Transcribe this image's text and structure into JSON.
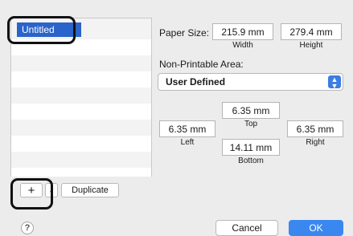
{
  "paper_list": {
    "selected_item": "Untitled"
  },
  "list_buttons": {
    "add": "+",
    "remove": "-",
    "duplicate": "Duplicate"
  },
  "paper_size": {
    "label": "Paper Size:",
    "width_value": "215.9 mm",
    "width_label": "Width",
    "height_value": "279.4 mm",
    "height_label": "Height"
  },
  "non_printable": {
    "label": "Non-Printable Area:",
    "selected_option": "User Defined",
    "top_value": "6.35 mm",
    "top_label": "Top",
    "left_value": "6.35 mm",
    "left_label": "Left",
    "right_value": "6.35 mm",
    "right_label": "Right",
    "bottom_value": "14.11 mm",
    "bottom_label": "Bottom"
  },
  "footer": {
    "help": "?",
    "cancel": "Cancel",
    "ok": "OK"
  },
  "colors": {
    "selection": "#2a63c9",
    "accent": "#3b87f0"
  }
}
